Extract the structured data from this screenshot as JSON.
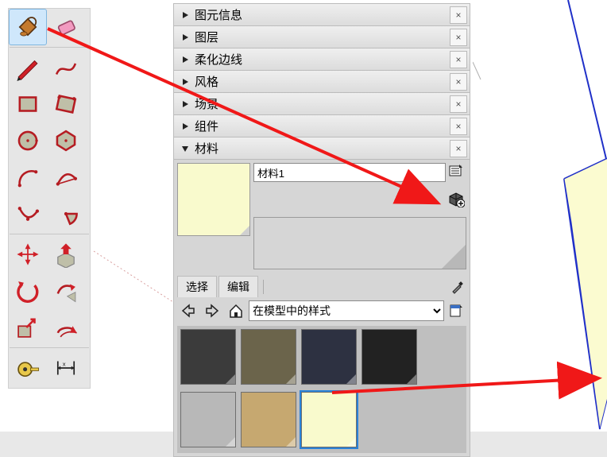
{
  "panels": [
    {
      "label": "图元信息",
      "expanded": false
    },
    {
      "label": "图层",
      "expanded": false
    },
    {
      "label": "柔化边线",
      "expanded": false
    },
    {
      "label": "风格",
      "expanded": false
    },
    {
      "label": "场景",
      "expanded": false
    },
    {
      "label": "组件",
      "expanded": false
    },
    {
      "label": "材料",
      "expanded": true
    }
  ],
  "materials": {
    "current_name": "材料1",
    "tabs": {
      "select": "选择",
      "edit": "编辑"
    },
    "library_select": "在模型中的样式",
    "swatches": [
      {
        "color": "#3b3b3b"
      },
      {
        "color": "#6b644b"
      },
      {
        "color": "#2d3141"
      },
      {
        "color": "#222222"
      },
      {
        "color": "#b8b8b8"
      },
      {
        "color": "#c6a870"
      },
      {
        "color": "#f9facd",
        "selected": true
      }
    ]
  },
  "icons": {
    "back": "⇦",
    "forward": "⇨",
    "home": "⌂",
    "eyedrop": "✎",
    "close": "×"
  }
}
